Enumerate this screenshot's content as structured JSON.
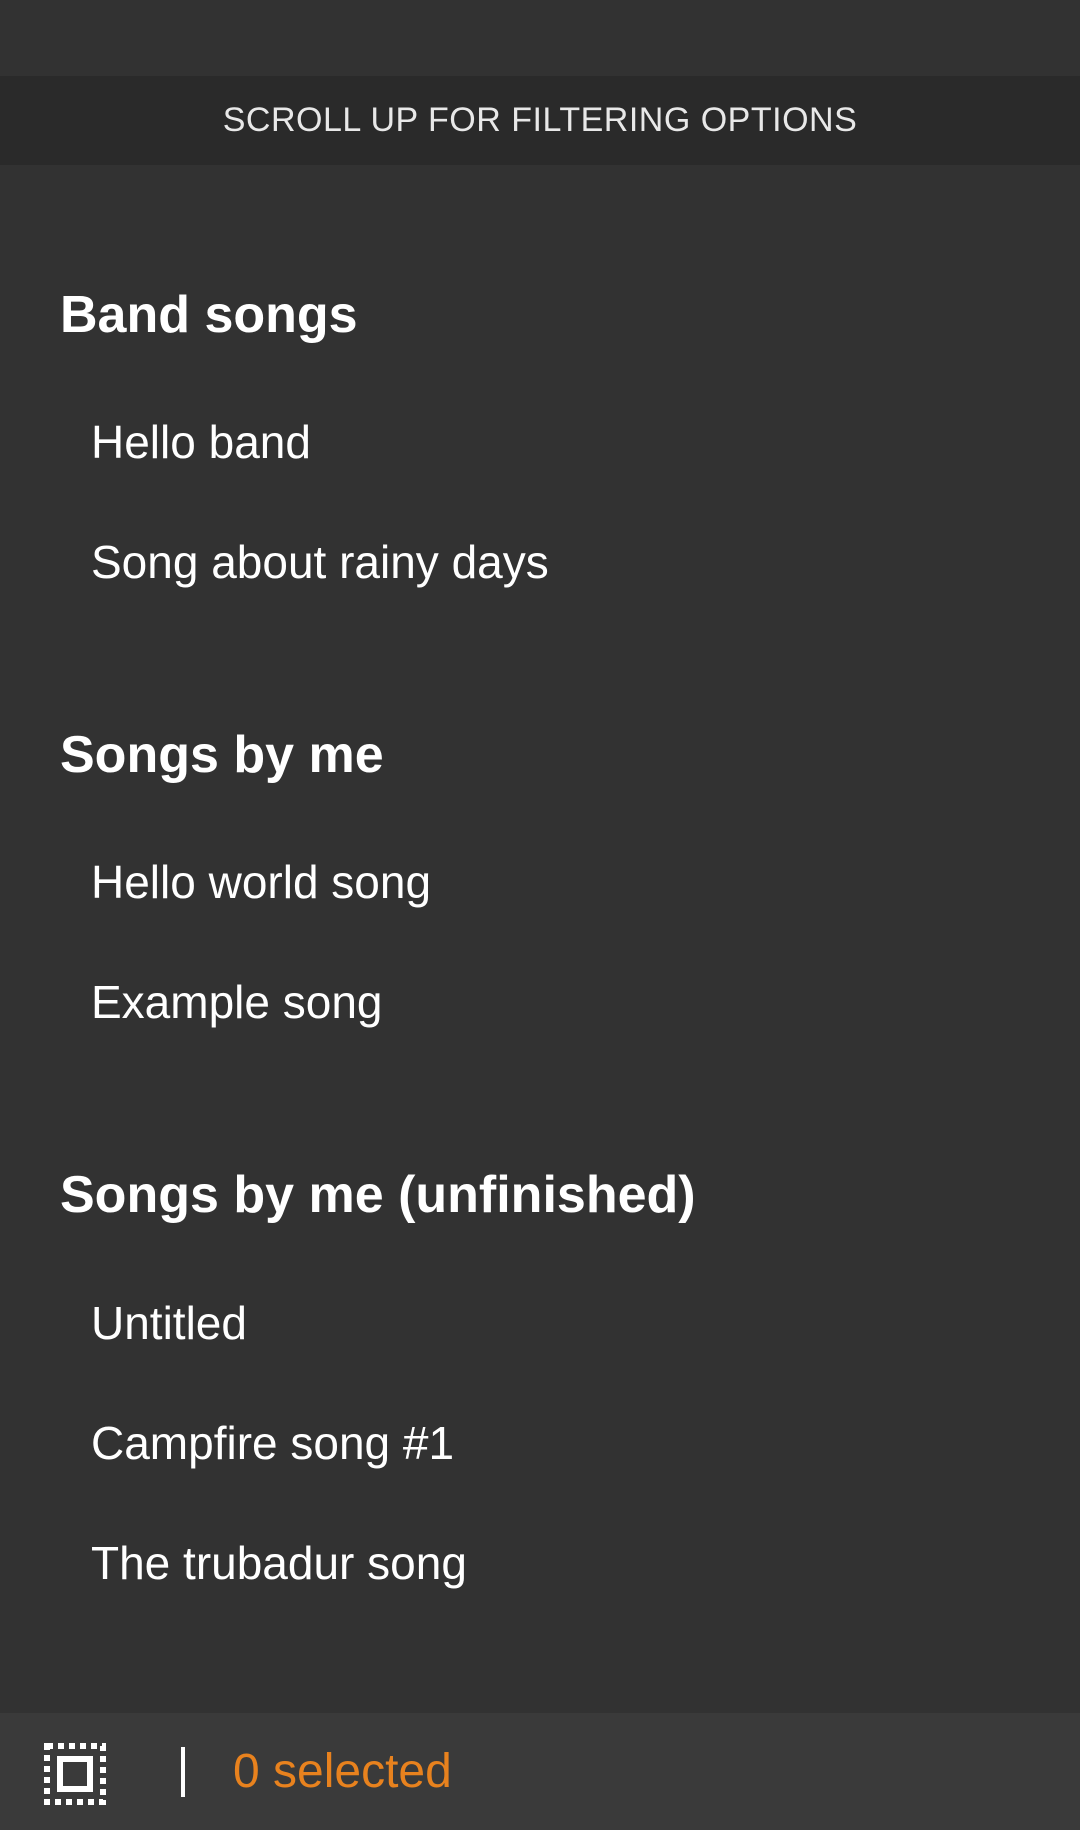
{
  "banner": {
    "text": "SCROLL UP FOR FILTERING OPTIONS"
  },
  "groups": [
    {
      "title": "Band songs",
      "songs": [
        "Hello band",
        "Song about rainy days"
      ]
    },
    {
      "title": "Songs by me",
      "songs": [
        "Hello world song",
        "Example song"
      ]
    },
    {
      "title": "Songs by me (unfinished)",
      "songs": [
        "Untitled",
        "Campfire song #1",
        "The trubadur song"
      ]
    }
  ],
  "bottom_bar": {
    "select_all_icon": "select-all-icon",
    "selected_text": "0 selected",
    "accent_color": "#e8821e"
  }
}
